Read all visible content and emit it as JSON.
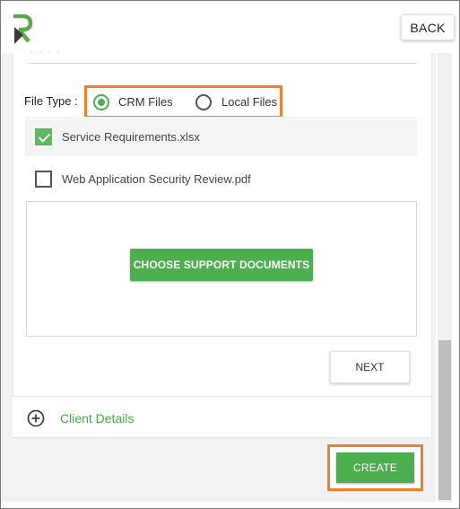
{
  "header": {
    "logo_icon": "app-logo-icon",
    "back_label": "BACK"
  },
  "form": {
    "file_type_label": "File Type :",
    "file_type_options": [
      {
        "label": "CRM Files",
        "selected": true
      },
      {
        "label": "Local Files",
        "selected": false
      }
    ],
    "files": [
      {
        "name": "Service Requirements.xlsx",
        "checked": true
      },
      {
        "name": "Web Application Security Review.pdf",
        "checked": false
      }
    ],
    "choose_docs_label": "CHOOSE SUPPORT DOCUMENTS",
    "next_label": "NEXT"
  },
  "sections": {
    "client_details_label": "Client Details",
    "client_details_icon": "plus-circle-icon"
  },
  "footer": {
    "create_label": "CREATE"
  },
  "colors": {
    "accent_green": "#4cae4c",
    "highlight_orange": "#f07f2c",
    "logo_green": "#5aa846"
  }
}
